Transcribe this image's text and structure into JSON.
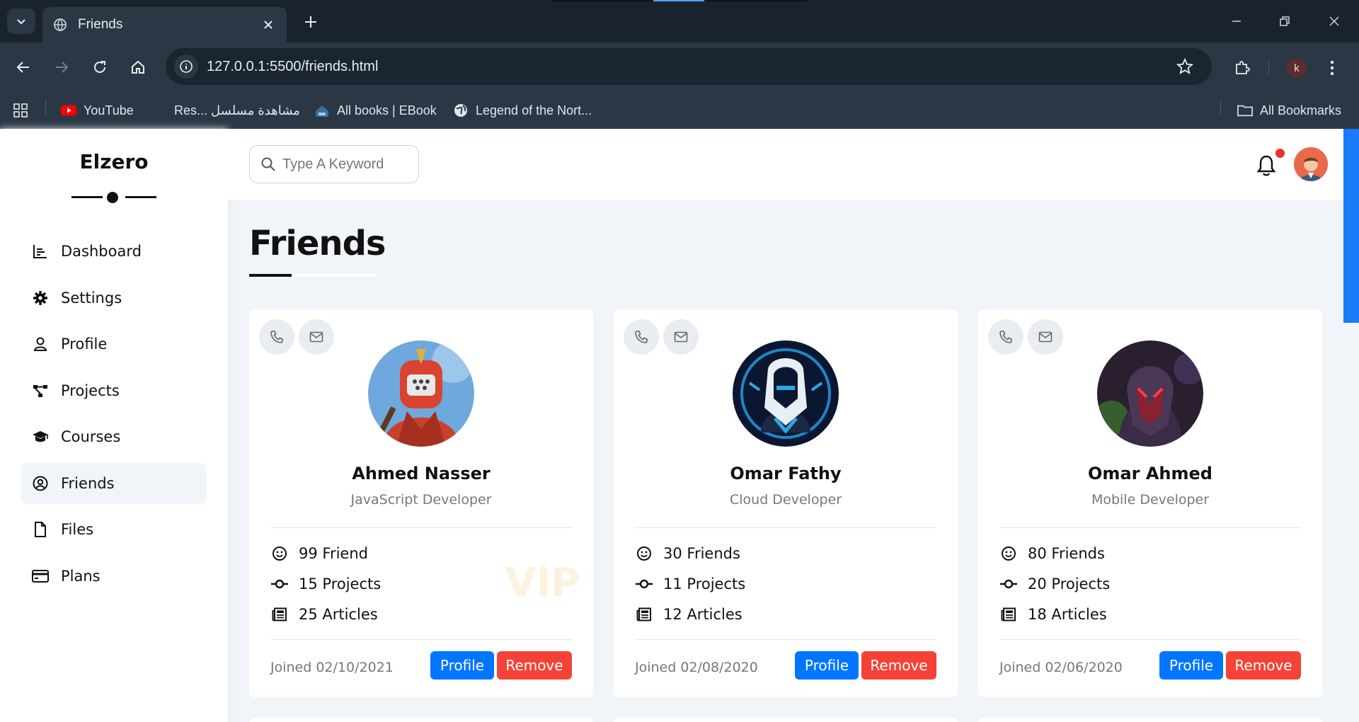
{
  "browser": {
    "tab_title": "Friends",
    "url": "127.0.0.1:5500/friends.html",
    "profile_initial": "k",
    "bookmarks": [
      {
        "label": "YouTube",
        "icon": "youtube-icon"
      },
      {
        "label": "Res... مشاهدة مسلسل",
        "icon": "page-icon"
      },
      {
        "label": "All books | EBook",
        "icon": "book-site-icon"
      },
      {
        "label": "Legend of the Nort...",
        "icon": "globe-icon"
      }
    ],
    "all_bookmarks_label": "All Bookmarks"
  },
  "sidebar": {
    "logo": "Elzero",
    "items": [
      {
        "label": "Dashboard",
        "icon": "chart-icon"
      },
      {
        "label": "Settings",
        "icon": "gear-icon"
      },
      {
        "label": "Profile",
        "icon": "user-icon"
      },
      {
        "label": "Projects",
        "icon": "diagram-icon"
      },
      {
        "label": "Courses",
        "icon": "graduation-cap-icon"
      },
      {
        "label": "Friends",
        "icon": "user-circle-icon",
        "active": true
      },
      {
        "label": "Files",
        "icon": "file-icon"
      },
      {
        "label": "Plans",
        "icon": "credit-card-icon"
      }
    ]
  },
  "header": {
    "search_placeholder": "Type A Keyword",
    "notification_dot_color": "#ef2e2e"
  },
  "main": {
    "title": "Friends",
    "friends": [
      {
        "name": "Ahmed Nasser",
        "role": "JavaScript Developer",
        "friends": "99 Friend",
        "projects": "15 Projects",
        "articles": "25 Articles",
        "joined": "Joined 02/10/2021",
        "vip": "VIP"
      },
      {
        "name": "Omar Fathy",
        "role": "Cloud Developer",
        "friends": "30 Friends",
        "projects": "11 Projects",
        "articles": "12 Articles",
        "joined": "Joined 02/08/2020"
      },
      {
        "name": "Omar Ahmed",
        "role": "Mobile Developer",
        "friends": "80 Friends",
        "projects": "20 Projects",
        "articles": "18 Articles",
        "joined": "Joined 02/06/2020"
      }
    ],
    "profile_label": "Profile",
    "remove_label": "Remove"
  },
  "colors": {
    "primary": "#0075ff",
    "danger": "#f44336",
    "background": "#f1f5f9"
  }
}
